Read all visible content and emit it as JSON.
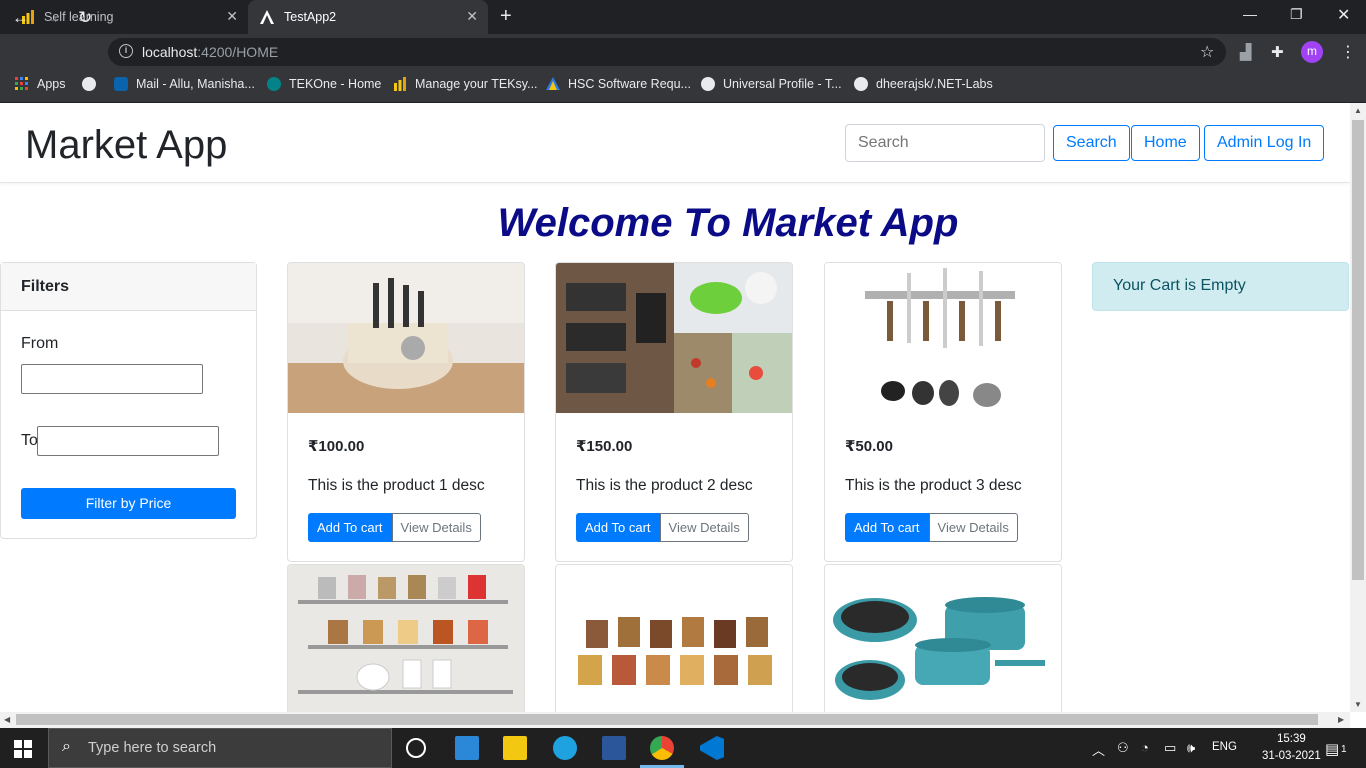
{
  "browser": {
    "tabs": [
      {
        "title": "Self learning",
        "active": false
      },
      {
        "title": "TestApp2",
        "active": true
      }
    ],
    "url_host": "localhost",
    "url_rest": ":4200/HOME",
    "profile_initial": "m",
    "bookmarks": [
      {
        "label": "Apps",
        "icon": "apps-grid-icon"
      },
      {
        "label": "",
        "icon": "globe-icon"
      },
      {
        "label": "Mail - Allu, Manisha...",
        "icon": "outlook-icon"
      },
      {
        "label": "TEKOne - Home",
        "icon": "sharepoint-icon"
      },
      {
        "label": "Manage your TEKsy...",
        "icon": "powerbi-icon"
      },
      {
        "label": "HSC Software Requ...",
        "icon": "azure-devops-icon"
      },
      {
        "label": "Universal Profile - T...",
        "icon": "globe-icon"
      },
      {
        "label": "dheerajsk/.NET-Labs",
        "icon": "github-icon"
      }
    ]
  },
  "app": {
    "brand": "Market App",
    "search_placeholder": "Search",
    "nav_buttons": [
      "Search",
      "Home",
      "Admin Log In"
    ],
    "welcome": "Welcome To Market App",
    "filters": {
      "title": "Filters",
      "from_label": "From",
      "to_label": "To",
      "button": "Filter by Price"
    },
    "cart_message": "Your Cart is Empty",
    "add_to_cart_label": "Add To cart",
    "view_details_label": "View Details",
    "products": [
      {
        "price": "₹100.00",
        "desc": "This is the product 1 desc",
        "image": "kitchen-utensil-holder"
      },
      {
        "price": "₹150.00",
        "desc": "This is the product 2 desc",
        "image": "kitchen-racks-collage"
      },
      {
        "price": "₹50.00",
        "desc": "This is the product 3 desc",
        "image": "knife-ladle-rack"
      },
      {
        "price": "",
        "desc": "",
        "image": "spice-jar-rack"
      },
      {
        "price": "",
        "desc": "",
        "image": "storage-jars"
      },
      {
        "price": "",
        "desc": "",
        "image": "teal-cookware-set"
      }
    ]
  },
  "taskbar": {
    "search_placeholder": "Type here to search",
    "language": "ENG",
    "time": "15:39",
    "date": "31-03-2021",
    "notification_count": "1"
  },
  "colors": {
    "primary": "#007bff",
    "welcome": "#0b0b87",
    "alert_bg": "#d1ecf1",
    "alert_text": "#0c5460"
  }
}
